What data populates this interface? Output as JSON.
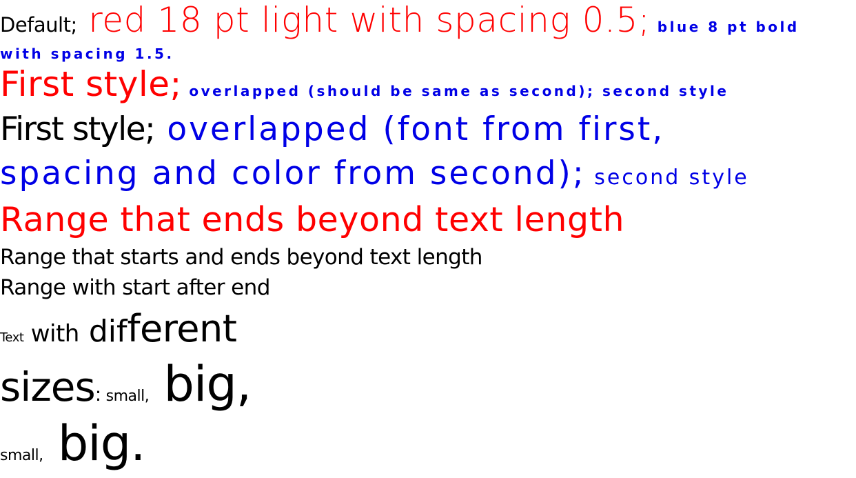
{
  "colors": {
    "default": "#000000",
    "red": "#ff0000",
    "blue": "#0000e6"
  },
  "p1": {
    "default": "Default;",
    "red": " red 18 pt light with spacing 0.5;",
    "blue_line1": " blue 8 pt bold",
    "blue_line2": "with spacing 1.5."
  },
  "p2": {
    "first": "First style;",
    "overlap_second": " overlapped (should be same as second); second style"
  },
  "p3": {
    "first": "First style;",
    "overlap_line1": " overlapped (font from first,",
    "overlap_line2": "spacing and color from second);",
    "second": " second style"
  },
  "p4": {
    "text": "Range that ends beyond text length"
  },
  "p5": {
    "text": "Range that starts and ends beyond text length"
  },
  "p6": {
    "text": "Range with start after end"
  },
  "p7": {
    "line1": {
      "a": "Text",
      "b": " with",
      "c": " dif",
      "d": "ferent"
    },
    "line2": {
      "a": "sizes",
      "b": ":",
      "c": " small,",
      "d": " big,"
    },
    "line3": {
      "a": "small,",
      "b": " big."
    }
  }
}
